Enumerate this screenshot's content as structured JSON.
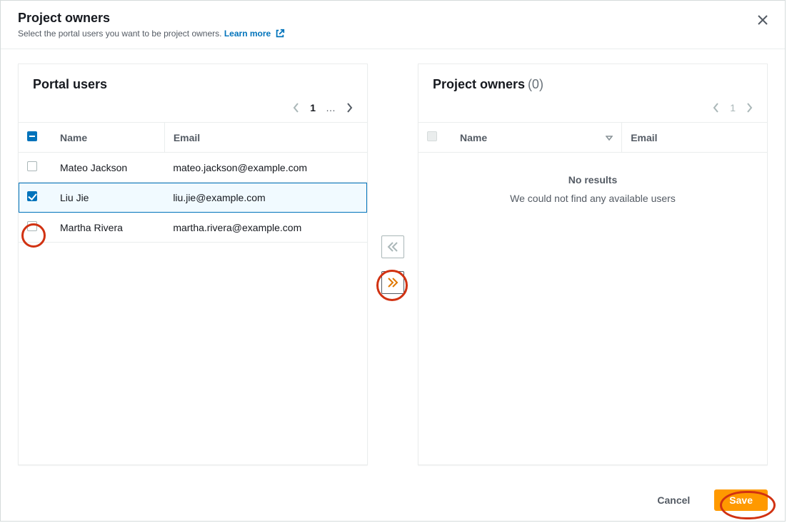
{
  "header": {
    "title": "Project owners",
    "subtitle": "Select the portal users you want to be project owners.",
    "learn_more": "Learn more"
  },
  "left_panel": {
    "title": "Portal users",
    "pagination": {
      "current": "1",
      "ellipsis": "…"
    },
    "columns": {
      "name": "Name",
      "email": "Email"
    },
    "rows": [
      {
        "checked": false,
        "name": "Mateo Jackson",
        "email": "mateo.jackson@example.com"
      },
      {
        "checked": true,
        "name": "Liu Jie",
        "email": "liu.jie@example.com"
      },
      {
        "checked": false,
        "name": "Martha Rivera",
        "email": "martha.rivera@example.com"
      }
    ]
  },
  "right_panel": {
    "title": "Project owners",
    "count": "(0)",
    "pagination": {
      "current": "1"
    },
    "columns": {
      "name": "Name",
      "email": "Email"
    },
    "empty_title": "No results",
    "empty_text": "We could not find any available users"
  },
  "footer": {
    "cancel": "Cancel",
    "save": "Save"
  }
}
